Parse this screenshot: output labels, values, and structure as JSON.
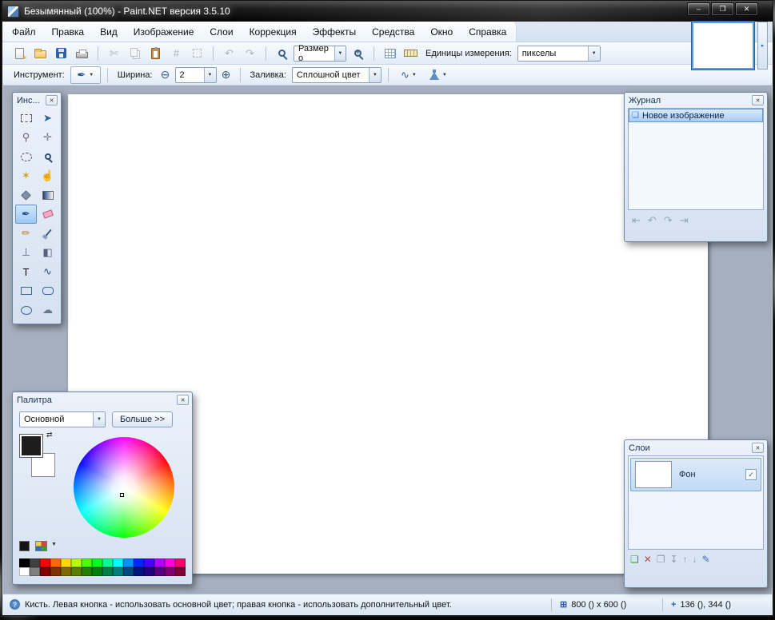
{
  "window": {
    "title": "Безымянный (100%) - Paint.NET версия 3.5.10",
    "minimize_glyph": "–",
    "maximize_glyph": "❐",
    "close_glyph": "✕"
  },
  "ui": {
    "panel_close_glyph": "✕",
    "dropdown_arrow": "▼",
    "thumb_scroll_glyph": "▸",
    "help_glyph": "?",
    "size_icon_glyph": "⊞",
    "position_icon_glyph": "+"
  },
  "menu": {
    "items": [
      {
        "label": "Файл"
      },
      {
        "label": "Правка"
      },
      {
        "label": "Вид"
      },
      {
        "label": "Изображение"
      },
      {
        "label": "Слои"
      },
      {
        "label": "Коррекция"
      },
      {
        "label": "Эффекты"
      },
      {
        "label": "Средства"
      },
      {
        "label": "Окно"
      },
      {
        "label": "Справка"
      }
    ]
  },
  "toolbar_main": {
    "zoom_combo_value": "Размер о",
    "units_label": "Единицы измерения:",
    "units_combo_value": "пикселы"
  },
  "toolbar_tool": {
    "tool_label": "Инструмент:",
    "tool_icon_glyph": "✒",
    "width_label": "Ширина:",
    "width_minus_glyph": "⊖",
    "width_value": "2",
    "width_plus_glyph": "⊕",
    "fill_label": "Заливка:",
    "fill_combo_value": "Сплошной цвет",
    "curve_glyph": "∿"
  },
  "tools_panel": {
    "title": "Инс...",
    "items": [
      {
        "name": "rectangle-select",
        "type": "dashed-rect",
        "glyph": ""
      },
      {
        "name": "move-selected-pixels",
        "glyph": "➤",
        "color": "#2f5f9f"
      },
      {
        "name": "lasso-select",
        "glyph": "⚲",
        "color": "#6b5d8f"
      },
      {
        "name": "move-selection",
        "glyph": "✛",
        "color": "#6f7f94"
      },
      {
        "name": "ellipse-select",
        "type": "dashed-ellipse",
        "glyph": ""
      },
      {
        "name": "zoom",
        "type": "magnifier",
        "glyph": ""
      },
      {
        "name": "magic-wand",
        "glyph": "✶",
        "color": "#c9a227"
      },
      {
        "name": "pan",
        "glyph": "☝",
        "color": "#b08040"
      },
      {
        "name": "paint-bucket",
        "type": "bucket",
        "glyph": ""
      },
      {
        "name": "gradient",
        "type": "gradient",
        "glyph": ""
      },
      {
        "name": "paintbrush",
        "glyph": "✒",
        "color": "#1f4e8c",
        "selected": true
      },
      {
        "name": "eraser",
        "type": "eraser",
        "glyph": ""
      },
      {
        "name": "pencil",
        "glyph": "✏",
        "color": "#c87f2f"
      },
      {
        "name": "color-picker",
        "type": "dropper",
        "glyph": ""
      },
      {
        "name": "clone-stamp",
        "glyph": "⊥",
        "color": "#55627a"
      },
      {
        "name": "recolor",
        "glyph": "◧",
        "color": "#55627a"
      },
      {
        "name": "text",
        "glyph": "T",
        "color": "#111111"
      },
      {
        "name": "line-curve",
        "glyph": "∿",
        "color": "#334f77"
      },
      {
        "name": "rectangle",
        "type": "rect",
        "glyph": ""
      },
      {
        "name": "rounded-rectangle",
        "type": "rounded",
        "glyph": ""
      },
      {
        "name": "ellipse",
        "type": "ellipse",
        "glyph": ""
      },
      {
        "name": "freeform-shape",
        "glyph": "☁",
        "color": "#66788d"
      }
    ]
  },
  "history_panel": {
    "title": "Журнал",
    "items": [
      {
        "label": "Новое изображение",
        "icon_glyph": "❏",
        "selected": true
      }
    ],
    "nav": [
      {
        "name": "rewind",
        "glyph": "⇤"
      },
      {
        "name": "undo",
        "glyph": "↶"
      },
      {
        "name": "redo",
        "glyph": "↷"
      },
      {
        "name": "fast-forward",
        "glyph": "⇥"
      }
    ]
  },
  "palette_panel": {
    "title": "Палитра",
    "mode_combo_value": "Основной",
    "more_button": "Больше >>",
    "primary_color": "#1d1d1d",
    "secondary_color": "#ffffff",
    "swap_glyph": "⇄",
    "mini_arrow_glyph": "▼",
    "swatches": [
      "#000000",
      "#404040",
      "#FF0000",
      "#FF6A00",
      "#FFD800",
      "#B6FF00",
      "#4CFF00",
      "#00FF21",
      "#00FF90",
      "#00FFFF",
      "#0094FF",
      "#0026FF",
      "#4800FF",
      "#B200FF",
      "#FF00DC",
      "#FF006E",
      "#FFFFFF",
      "#808080",
      "#7F0000",
      "#7F3300",
      "#7F6A00",
      "#5B7F00",
      "#267F00",
      "#007F0E",
      "#007F46",
      "#007F7F",
      "#004A7F",
      "#00137F",
      "#21007F",
      "#57007F",
      "#7F006E",
      "#7F0037"
    ]
  },
  "layers_panel": {
    "title": "Слои",
    "layers": [
      {
        "name": "Фон",
        "check": "✓",
        "selected": true
      }
    ],
    "buttons": [
      {
        "name": "add-layer",
        "glyph": "❏",
        "color": "#3f9b3f"
      },
      {
        "name": "delete-layer",
        "glyph": "✕",
        "color": "#b05050"
      },
      {
        "name": "duplicate-layer",
        "glyph": "❐",
        "color": "#8a99ad"
      },
      {
        "name": "merge-layer-down",
        "glyph": "↧",
        "color": "#8a99ad"
      },
      {
        "name": "move-layer-up",
        "glyph": "↑",
        "color": "#8a99ad"
      },
      {
        "name": "move-layer-down",
        "glyph": "↓",
        "color": "#8a99ad"
      },
      {
        "name": "layer-properties",
        "glyph": "✎",
        "color": "#3b6fae"
      }
    ]
  },
  "statusbar": {
    "message": "Кисть. Левая кнопка - использовать основной цвет; правая кнопка - использовать дополнительный цвет.",
    "image_size": "800 () x 600 ()",
    "cursor_position": "136 (), 344 ()"
  }
}
